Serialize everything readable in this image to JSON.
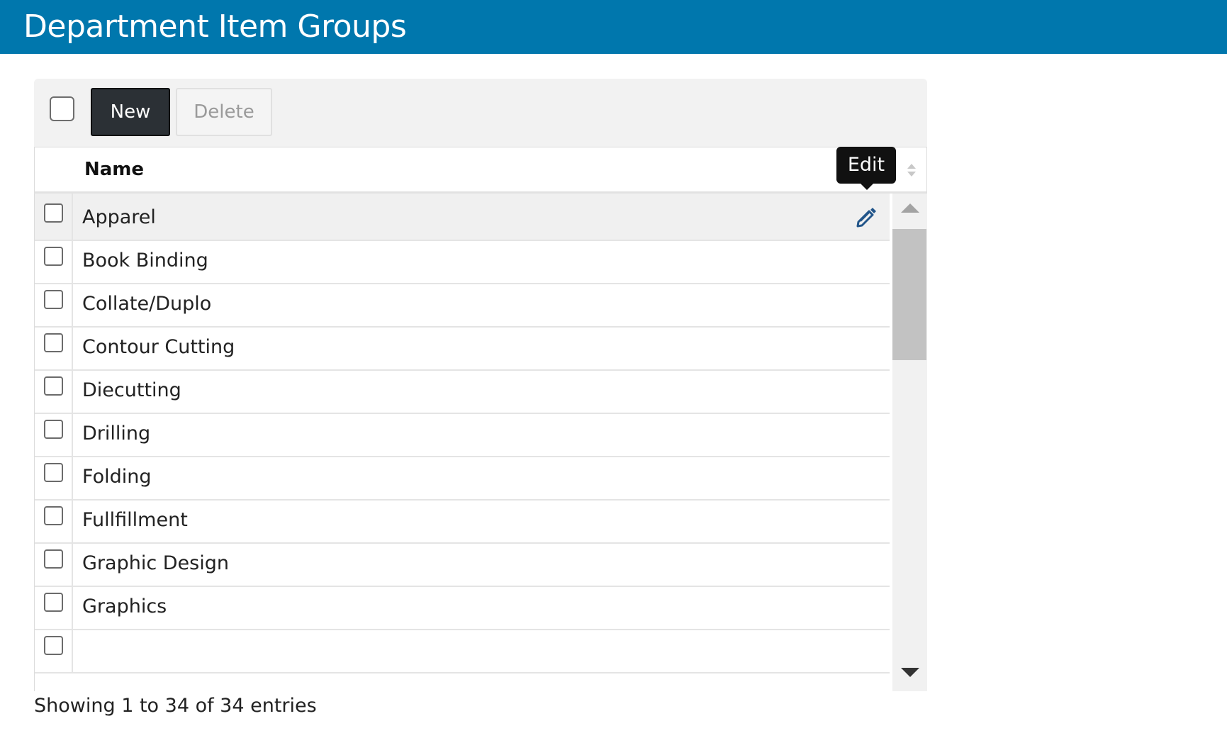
{
  "header": {
    "title": "Department Item Groups"
  },
  "toolbar": {
    "new_label": "New",
    "delete_label": "Delete"
  },
  "table": {
    "column_name": "Name",
    "tooltip": "Edit",
    "rows": [
      {
        "name": "Apparel"
      },
      {
        "name": "Book Binding"
      },
      {
        "name": "Collate/Duplo"
      },
      {
        "name": "Contour Cutting"
      },
      {
        "name": "Diecutting"
      },
      {
        "name": "Drilling"
      },
      {
        "name": "Folding"
      },
      {
        "name": "Fullfillment"
      },
      {
        "name": "Graphic Design"
      },
      {
        "name": "Graphics"
      }
    ]
  },
  "footer": {
    "info": "Showing 1 to 34 of 34 entries"
  },
  "colors": {
    "header_bg": "#0077ad",
    "edit_icon": "#23568a"
  }
}
